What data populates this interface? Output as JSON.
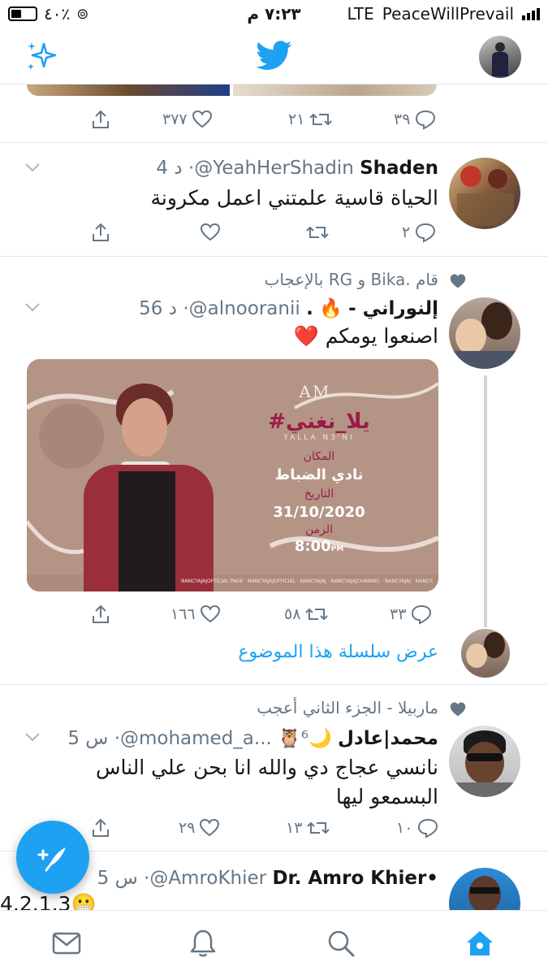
{
  "status_bar": {
    "battery": "٤٠٪",
    "time": "٧:٢٣ م",
    "network": "LTE",
    "carrier": "PeaceWillPrevail"
  },
  "nav": {
    "sparkle_icon": "sparkle-icon",
    "logo_icon": "twitter-bird-icon",
    "profile_icon": "avatar"
  },
  "colors": {
    "brand": "#1da1f2",
    "text": "#14171a",
    "secondary": "#657786",
    "divider": "#e1e8ed",
    "heart": "#e0245e"
  },
  "tweets": [
    {
      "actions": {
        "reply": "٣٩",
        "retweet": "٢١",
        "like": "٣٧٧",
        "share": ""
      }
    },
    {
      "name": "Shaden",
      "handle": "@YeahHerShadin",
      "dot": "·",
      "time": "4 د",
      "text": "الحياة قاسية علمتني اعمل مكرونة",
      "actions": {
        "reply": "٢",
        "retweet": "",
        "like": "",
        "share": ""
      }
    },
    {
      "social": "قام .Bika و RG بالإعجاب",
      "name": "- إلنوراني",
      "emoji": "🔥",
      "name_suffix": ".",
      "handle": "@alnooranii",
      "dot": "·",
      "time": "56 د",
      "text": "اصنعوا يومكم ❤️",
      "poster": {
        "logo": "AM",
        "hashtag": "#يلا_نغني",
        "subtitle": "YALLA N3'NI",
        "venue_label": "المكان",
        "venue": "نادي الضباط",
        "date_label": "التاريخ",
        "date": "31/10/2020",
        "time_label": "الزمن",
        "time": "8:00",
        "time_suffix": "PM",
        "footer": "NANCYAJAJOFFICIAL PAGE · NANCYAJAJOFFICIAL · NANCYAJAJ · NANCYAJAJCHANNEL · NANCYAJAJ · NANCYAJAJOFFICIAL"
      },
      "actions": {
        "reply": "٣٣",
        "retweet": "٥٨",
        "like": "١٦٦",
        "share": ""
      },
      "show_thread": "عرض سلسلة هذا الموضوع"
    },
    {
      "social": "ماربيلا - الجزء الثاني أعجب",
      "name": "محمد|عادل",
      "emoji": "🦉⁶🌙",
      "handle": "@mohamed_a...",
      "dot": "·",
      "time": "5 س",
      "text": "نانسي عجاج دي والله انا بحن علي الناس البسمعو ليها",
      "actions": {
        "reply": "١٠",
        "retweet": "١٣",
        "like": "٢٩",
        "share": ""
      }
    },
    {
      "name": "Dr. Amro Khier•",
      "handle": "@AmroKhier",
      "dot": "·",
      "time": "5 س",
      "text": "4.2.1.3😬"
    }
  ],
  "tabs": [
    "home-icon",
    "search-icon",
    "bell-icon",
    "mail-icon"
  ]
}
